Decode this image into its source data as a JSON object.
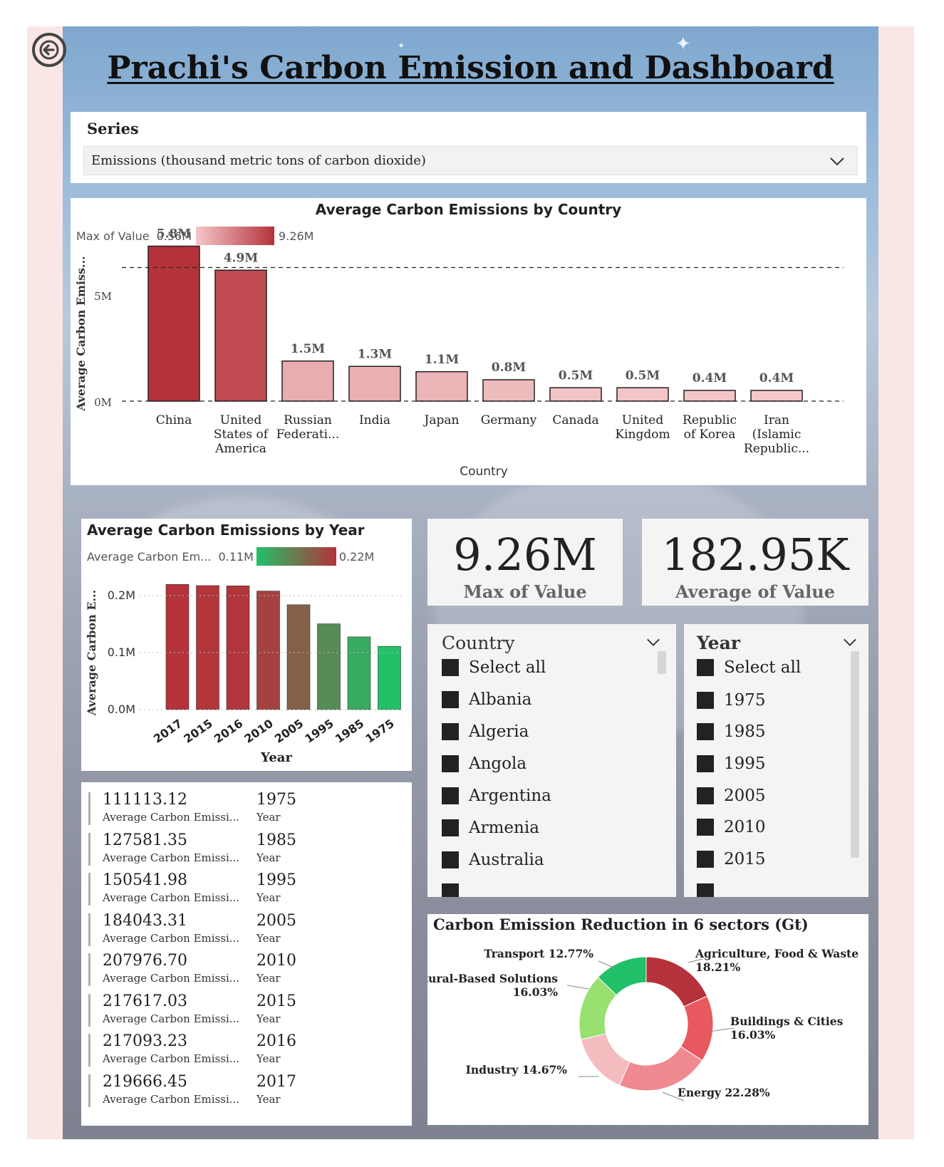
{
  "page": {
    "title": "Prachi's Carbon Emission and Dashboard"
  },
  "series_slicer": {
    "label": "Series",
    "selected": "Emissions (thousand metric tons of carbon dioxide)"
  },
  "country_chart": {
    "title": "Average Carbon Emissions by Country",
    "legend_label": "Max of Value",
    "legend_min": "0.56M",
    "legend_max": "9.26M",
    "ylabel": "Average Carbon Emiss...",
    "xlabel": "Country",
    "tick_labels": [
      "5M",
      "0M"
    ]
  },
  "year_chart": {
    "title": "Average Carbon Emissions by Year",
    "legend_label": "Average Carbon Em...",
    "legend_min": "0.11M",
    "legend_max": "0.22M",
    "ylabel": "Average Carbon E...",
    "xlabel": "Year",
    "tick_labels": [
      "0.2M",
      "0.1M",
      "0.0M"
    ]
  },
  "chart_data": [
    {
      "type": "bar",
      "title": "Average Carbon Emissions by Country",
      "xlabel": "Country",
      "ylabel": "Average Carbon Emiss...",
      "categories": [
        "China",
        "United States of America",
        "Russian Federati...",
        "India",
        "Japan",
        "Germany",
        "Canada",
        "United Kingdom",
        "Republic of Korea",
        "Iran (Islamic Republic..."
      ],
      "category_lines": [
        [
          "China"
        ],
        [
          "United",
          "States of",
          "America"
        ],
        [
          "Russian",
          "Federati..."
        ],
        [
          "India"
        ],
        [
          "Japan"
        ],
        [
          "Germany"
        ],
        [
          "Canada"
        ],
        [
          "United",
          "Kingdom"
        ],
        [
          "Republic",
          "of Korea"
        ],
        [
          "Iran",
          "(Islamic",
          "Republic..."
        ]
      ],
      "values": [
        5.8,
        4.9,
        1.5,
        1.3,
        1.1,
        0.8,
        0.5,
        0.5,
        0.4,
        0.4
      ],
      "data_labels": [
        "5.8M",
        "4.9M",
        "1.5M",
        "1.3M",
        "1.1M",
        "0.8M",
        "0.5M",
        "0.5M",
        "0.4M",
        "0.4M"
      ],
      "color_values": [
        9.26,
        7.8,
        2.1,
        1.9,
        1.6,
        1.2,
        0.8,
        0.7,
        0.6,
        0.56
      ],
      "ylim": [
        0,
        6
      ],
      "gridlines": [
        0,
        5
      ],
      "legend": "top-left"
    },
    {
      "type": "bar",
      "title": "Average Carbon Emissions by Year",
      "xlabel": "Year",
      "ylabel": "Average Carbon E...",
      "categories": [
        "2017",
        "2015",
        "2016",
        "2010",
        "2005",
        "1995",
        "1985",
        "1975"
      ],
      "values": [
        0.2197,
        0.2176,
        0.2171,
        0.208,
        0.184,
        0.1505,
        0.1276,
        0.1111
      ],
      "ylim": [
        0,
        0.23
      ],
      "gridlines": [
        0,
        0.1,
        0.2
      ],
      "legend": "top-left"
    },
    {
      "type": "pie",
      "title": "Carbon Emission Reduction in 6 sectors (Gt)",
      "slices": [
        {
          "label": "Agriculture, Food & Waste",
          "pct": "18.21%",
          "value": 18.21,
          "color": "#b5323a"
        },
        {
          "label": "Buildings & Cities",
          "pct": "16.03%",
          "value": 16.03,
          "color": "#e85a5f"
        },
        {
          "label": "Energy",
          "pct": "22.28%",
          "value": 22.28,
          "color": "#ef8a90"
        },
        {
          "label": "Industry",
          "pct": "14.67%",
          "value": 14.67,
          "color": "#f5bcc0"
        },
        {
          "label": "Natural-Based Solutions",
          "pct": "16.03%",
          "value": 16.03,
          "color": "#98e06f"
        },
        {
          "label": "Transport",
          "pct": "12.77%",
          "value": 12.77,
          "color": "#22c068"
        }
      ]
    }
  ],
  "cards": [
    {
      "value": "9.26M",
      "label": "Max of Value"
    },
    {
      "value": "182.95K",
      "label": "Average of Value"
    }
  ],
  "country_slicer": {
    "header": "Country",
    "items": [
      "Select all",
      "Albania",
      "Algeria",
      "Angola",
      "Argentina",
      "Armenia",
      "Australia"
    ]
  },
  "year_slicer": {
    "header": "Year",
    "items": [
      "Select all",
      "1975",
      "1985",
      "1995",
      "2005",
      "2010",
      "2015"
    ]
  },
  "multi_card": {
    "rows": [
      {
        "value": "111113.12",
        "sub": "Average Carbon Emissi...",
        "year": "1975",
        "year_sub": "Year"
      },
      {
        "value": "127581.35",
        "sub": "Average Carbon Emissi...",
        "year": "1985",
        "year_sub": "Year"
      },
      {
        "value": "150541.98",
        "sub": "Average Carbon Emissi...",
        "year": "1995",
        "year_sub": "Year"
      },
      {
        "value": "184043.31",
        "sub": "Average Carbon Emissi...",
        "year": "2005",
        "year_sub": "Year"
      },
      {
        "value": "207976.70",
        "sub": "Average Carbon Emissi...",
        "year": "2010",
        "year_sub": "Year"
      },
      {
        "value": "217617.03",
        "sub": "Average Carbon Emissi...",
        "year": "2015",
        "year_sub": "Year"
      },
      {
        "value": "217093.23",
        "sub": "Average Carbon Emissi...",
        "year": "2016",
        "year_sub": "Year"
      },
      {
        "value": "219666.45",
        "sub": "Average Carbon Emissi...",
        "year": "2017",
        "year_sub": "Year"
      }
    ]
  },
  "colors": {
    "bar_low": "#f4c7c9",
    "bar_high": "#b5323a",
    "year_low": "#22c068",
    "year_high": "#b5323a"
  },
  "icons": {
    "back": "back-arrow-icon",
    "dropdown": "chevron-down-icon"
  }
}
